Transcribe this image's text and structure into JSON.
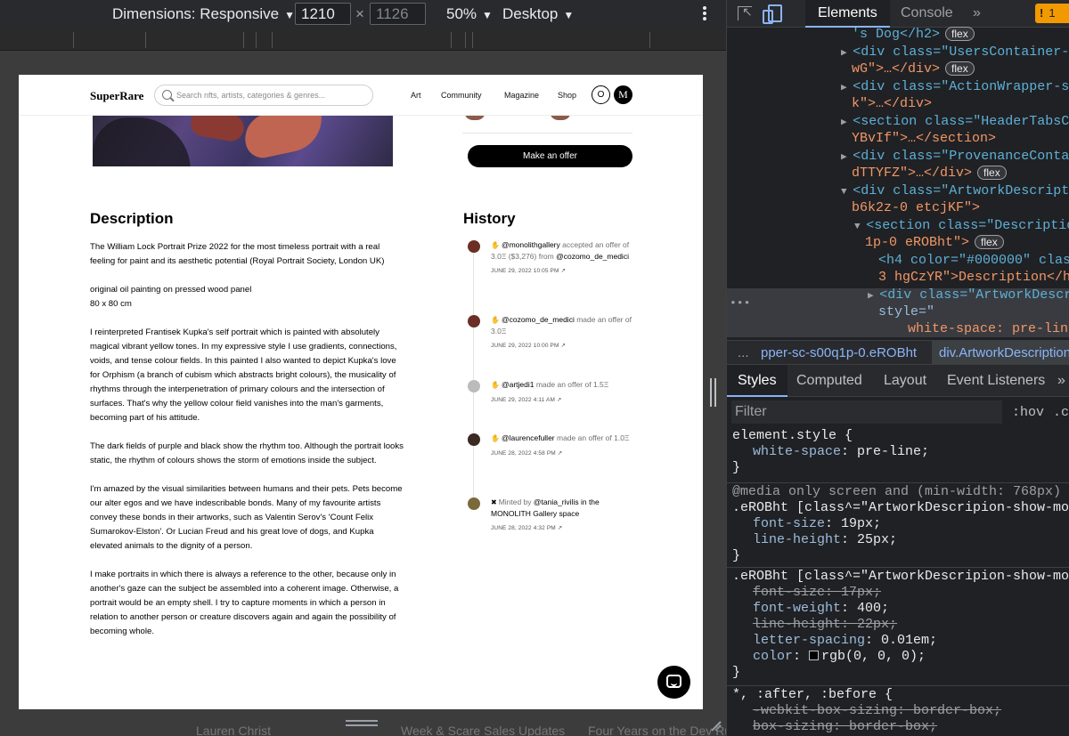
{
  "device_toolbar": {
    "dimensions_label": "Dimensions: Responsive",
    "width": "1210",
    "height": "1126",
    "times": "×",
    "zoom": "50%",
    "mode": "Desktop"
  },
  "site": {
    "logo": "SuperRare",
    "search_placeholder": "Search nfts, artists, categories & genres...",
    "nav": [
      "Art",
      "Community",
      "Magazine",
      "Shop"
    ],
    "circle_o": "O",
    "circle_m": "M",
    "offer_button": "Make an offer",
    "description_heading": "Description",
    "description": [
      "The William Lock Portrait Prize 2022 for the most timeless portrait with a real feeling for paint and its aesthetic potential (Royal Portrait Society, London UK)",
      "original oil painting on pressed wood panel\n80 x 80 cm",
      "I reinterpreted Frantisek Kupka's self portrait which is painted with absolutely magical vibrant yellow tones. In my expressive style I use gradients, connections, voids, and tense colour fields. In this painted I also wanted to depict Kupka's love for Orphism (a branch of cubism which abstracts bright colours), the musicality of rhythms through the interpenetration of primary colours and the intersection of surfaces. That's why the yellow colour field vanishes into the man's garments, becoming part of his attitude.",
      "The dark fields of purple and black show the rhythm too. Although the portrait looks static, the rhythm of colours shows the storm of emotions inside the subject.",
      "I'm amazed by the visual similarities between humans and their pets. Pets become our alter egos and we have indescribable bonds. Many of my favourite artists convey these bonds in their artworks, such as Valentin Serov's 'Count Felix Sumarokov-Elston'. Or Lucian Freud and his great love of dogs, and Kupka elevated animals to the dignity of a person.",
      "I make portraits in which there is always a reference to the other, because only in another's gaze can the subject be assembled into a coherent image. Otherwise, a portrait would be an empty shell. I try to capture moments in which a person in relation to another person or creature discovers again and again the possibility of becoming whole."
    ],
    "history_heading": "History",
    "history": [
      {
        "icon": "✋",
        "user": "@monolithgallery",
        "action": " accepted an offer of 3.0Ξ ($3,276) from ",
        "target": "@cozomo_de_medici",
        "date": "JUNE 29, 2022 10:05 PM ↗"
      },
      {
        "icon": "✋",
        "user": "@cozomo_de_medici",
        "action": " made an offer of 3.0Ξ",
        "target": "",
        "date": "JUNE 29, 2022 10:00 PM ↗"
      },
      {
        "icon": "✋",
        "user": "@artjedi1",
        "action": " made an offer of 1.5Ξ",
        "target": "",
        "date": "JUNE 29, 2022 4:11 AM ↗"
      },
      {
        "icon": "✋",
        "user": "@laurencefuller",
        "action": " made an offer of 1.0Ξ",
        "target": "",
        "date": "JUNE 28, 2022 4:58 PM ↗"
      },
      {
        "icon": "✖",
        "user": "Minted by ",
        "action": "@tania_rivilis",
        "target": " in the MONOLITH Gallery space",
        "date": "JUNE 28, 2022 4:32 PM ↗"
      }
    ]
  },
  "bottom_ghost": [
    "Lauren Christ",
    "Week & Scare Sales Updates",
    "Four Years on the Dev Rug Market"
  ],
  "devtools": {
    "tabs": [
      "Elements",
      "Console",
      "»"
    ],
    "warning_count": "1",
    "dom_lines": [
      {
        "t": "'s Dog</h2>",
        "flex": true
      },
      {
        "t": "<div class=\"UsersContainer-sc-",
        "cont": "wG\">…</div>",
        "flex": true
      },
      {
        "t": "<div class=\"ActionWrapper-sc-",
        "cont": "k\">…</div>",
        "flex": false
      },
      {
        "t": "<section class=\"HeaderTabsCon",
        "cont": "YBvIf\">…</section>",
        "flex": false
      },
      {
        "t": "<div class=\"ProvenanceContain",
        "cont": "dTTYFZ\">…</div>",
        "flex": true
      },
      {
        "t": "<div class=\"ArtworkDescriptio",
        "cont": "b6k2z-0 etcjKF\">",
        "flex": false
      },
      {
        "t": "<section class=\"DescriptionW",
        "cont": "1p-0 eROBht\">",
        "flex": true
      },
      {
        "t": "<h4 color=\"#000000\" class=",
        "cont": "3 hgCzYR\">Description</h4>",
        "flex": false
      },
      {
        "t": "<div class=\"ArtworkDescrip",
        "cont": "style=\"",
        "cont2": "white-space: pre-line;",
        "flex": false
      }
    ],
    "breadcrumb_1": "pper-sc-s00q1p-0.eROBht",
    "breadcrumb_2": "div.ArtworkDescription",
    "styles_tabs": [
      "Styles",
      "Computed",
      "Layout",
      "Event Listeners",
      "»"
    ],
    "filter_placeholder": "Filter",
    "hov": ":hov",
    "cls": ".cls",
    "rules": [
      {
        "selector": "element.style {",
        "decls": [
          {
            "p": "white-space",
            "v": "pre-line;",
            "s": false
          }
        ]
      },
      {
        "media": "@media only screen and (min-width: 768px)",
        "selector": ".eROBht [class^=\"ArtworkDescripion-show-more\"]",
        "decls": [
          {
            "p": "font-size",
            "v": "19px;",
            "s": false
          },
          {
            "p": "line-height",
            "v": "25px;",
            "s": false
          }
        ]
      },
      {
        "selector": ".eROBht [class^=\"ArtworkDescripion-show-more\"]",
        "decls": [
          {
            "p": "font-size",
            "v": "17px;",
            "s": true
          },
          {
            "p": "font-weight",
            "v": "400;",
            "s": false
          },
          {
            "p": "line-height",
            "v": "22px;",
            "s": true
          },
          {
            "p": "letter-spacing",
            "v": "0.01em;",
            "s": false
          },
          {
            "p": "color",
            "v": "rgb(0, 0, 0);",
            "s": false,
            "swatch": "#000000"
          }
        ]
      },
      {
        "selector": "*, :after, :before {",
        "decls": [
          {
            "p": "-webkit-box-sizing",
            "v": "border-box;",
            "s": true
          },
          {
            "p": "box-sizing",
            "v": "border-box;",
            "s": true
          }
        ]
      }
    ]
  }
}
